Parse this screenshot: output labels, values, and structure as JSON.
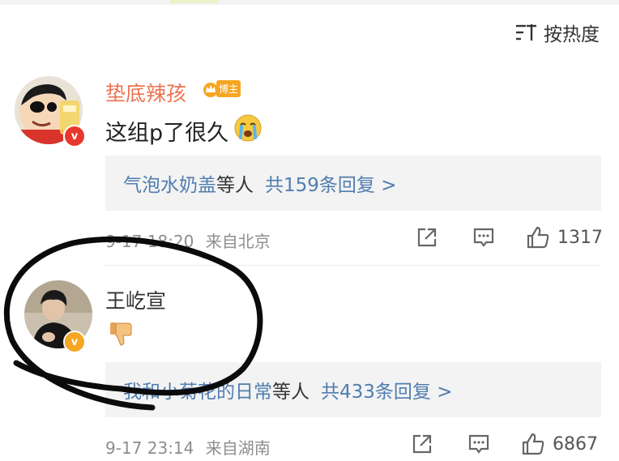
{
  "sort": {
    "label": "按热度",
    "icon": "sort-icon"
  },
  "comments": [
    {
      "username": "垫底辣孩",
      "badge_label": "博主",
      "text": "这组p了很久",
      "emoji": "crying-emoji",
      "replies": {
        "names": "气泡水奶盖",
        "suffix": "等人",
        "total": "共159条回复 >"
      },
      "timestamp": "9-17 18:20",
      "location": "来自北京",
      "likes": "1317",
      "verified_color": "#e8372c"
    },
    {
      "username": "王屹宣",
      "emoji": "thumbs-down-emoji",
      "replies": {
        "names": "我和小菊花的日常",
        "suffix": "等人",
        "total": "共433条回复 >"
      },
      "timestamp": "9-17 23:14",
      "location": "来自湖南",
      "likes": "6867",
      "verified_color": "#f5a623"
    }
  ],
  "colors": {
    "username_highlight": "#eb7350",
    "reply_link": "#507daf",
    "meta_text": "#8d8d8d",
    "reply_bg": "#f3f3f3"
  }
}
